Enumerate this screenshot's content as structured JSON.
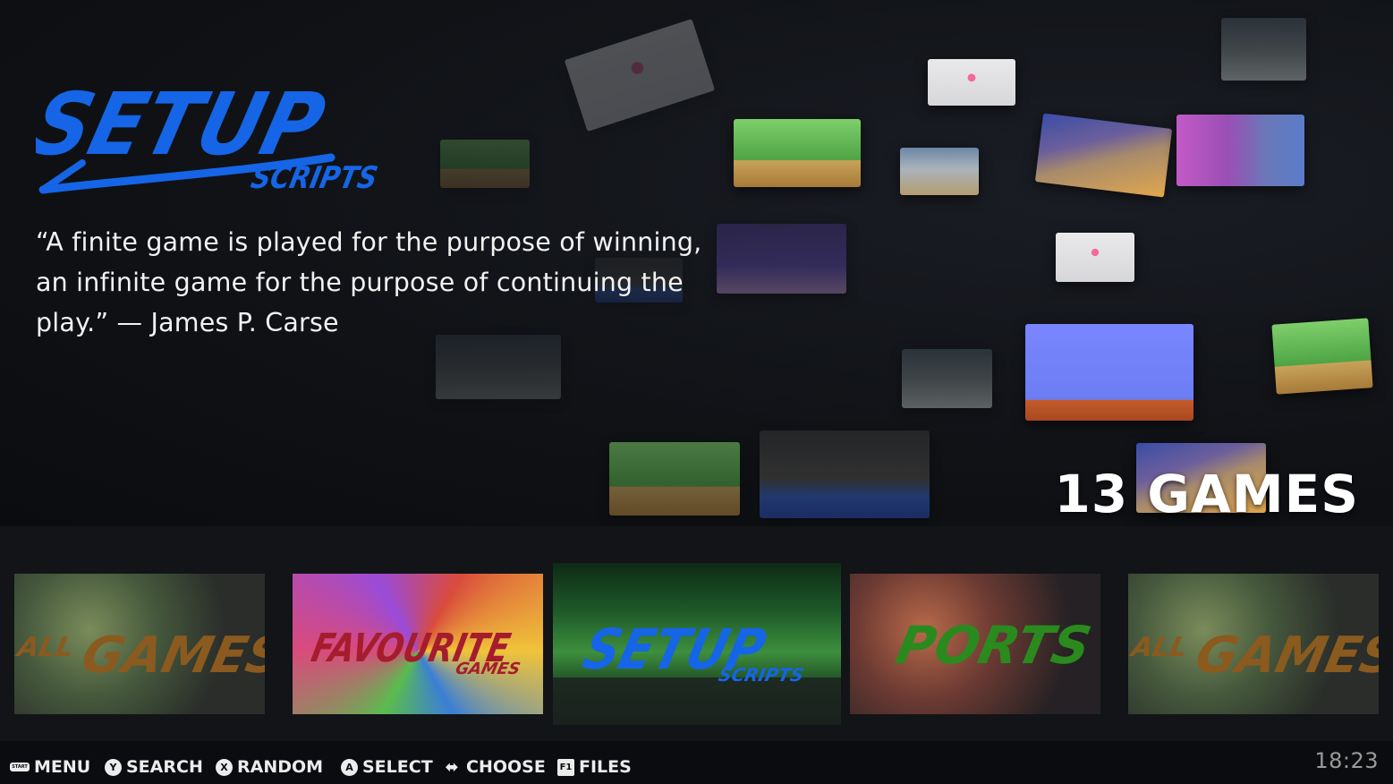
{
  "system": {
    "logo_main": "SETUP",
    "logo_sub": "SCRIPTS",
    "quote": "“A finite game is played for the purpose of winning, an infinite game for the purpose of continuing the play.” — James P. Carse",
    "game_count_label": "13 GAMES",
    "accent_color": "#1565e6"
  },
  "carousel": {
    "items": [
      {
        "title": "ALL",
        "subtitle": "GAMES",
        "color": "#8a5a1e"
      },
      {
        "title": "FAVOURITE",
        "subtitle": "GAMES",
        "color": "#a51d2d"
      },
      {
        "title": "SETUP",
        "subtitle": "SCRIPTS",
        "color": "#1565e6",
        "selected": true
      },
      {
        "title": "PORTS",
        "subtitle": "",
        "color": "#2a8a1e"
      },
      {
        "title": "ALL",
        "subtitle": "GAMES",
        "color": "#8a5a1e"
      }
    ]
  },
  "hints": {
    "menu_icon": "START",
    "menu": "MENU",
    "search_icon": "Y",
    "search": "SEARCH",
    "random_icon": "X",
    "random": "RANDOM",
    "select_icon": "A",
    "select": "SELECT",
    "choose_icon": "⬌",
    "choose": "CHOOSE",
    "files_icon": "F1",
    "files": "FILES"
  },
  "clock": "18:23"
}
